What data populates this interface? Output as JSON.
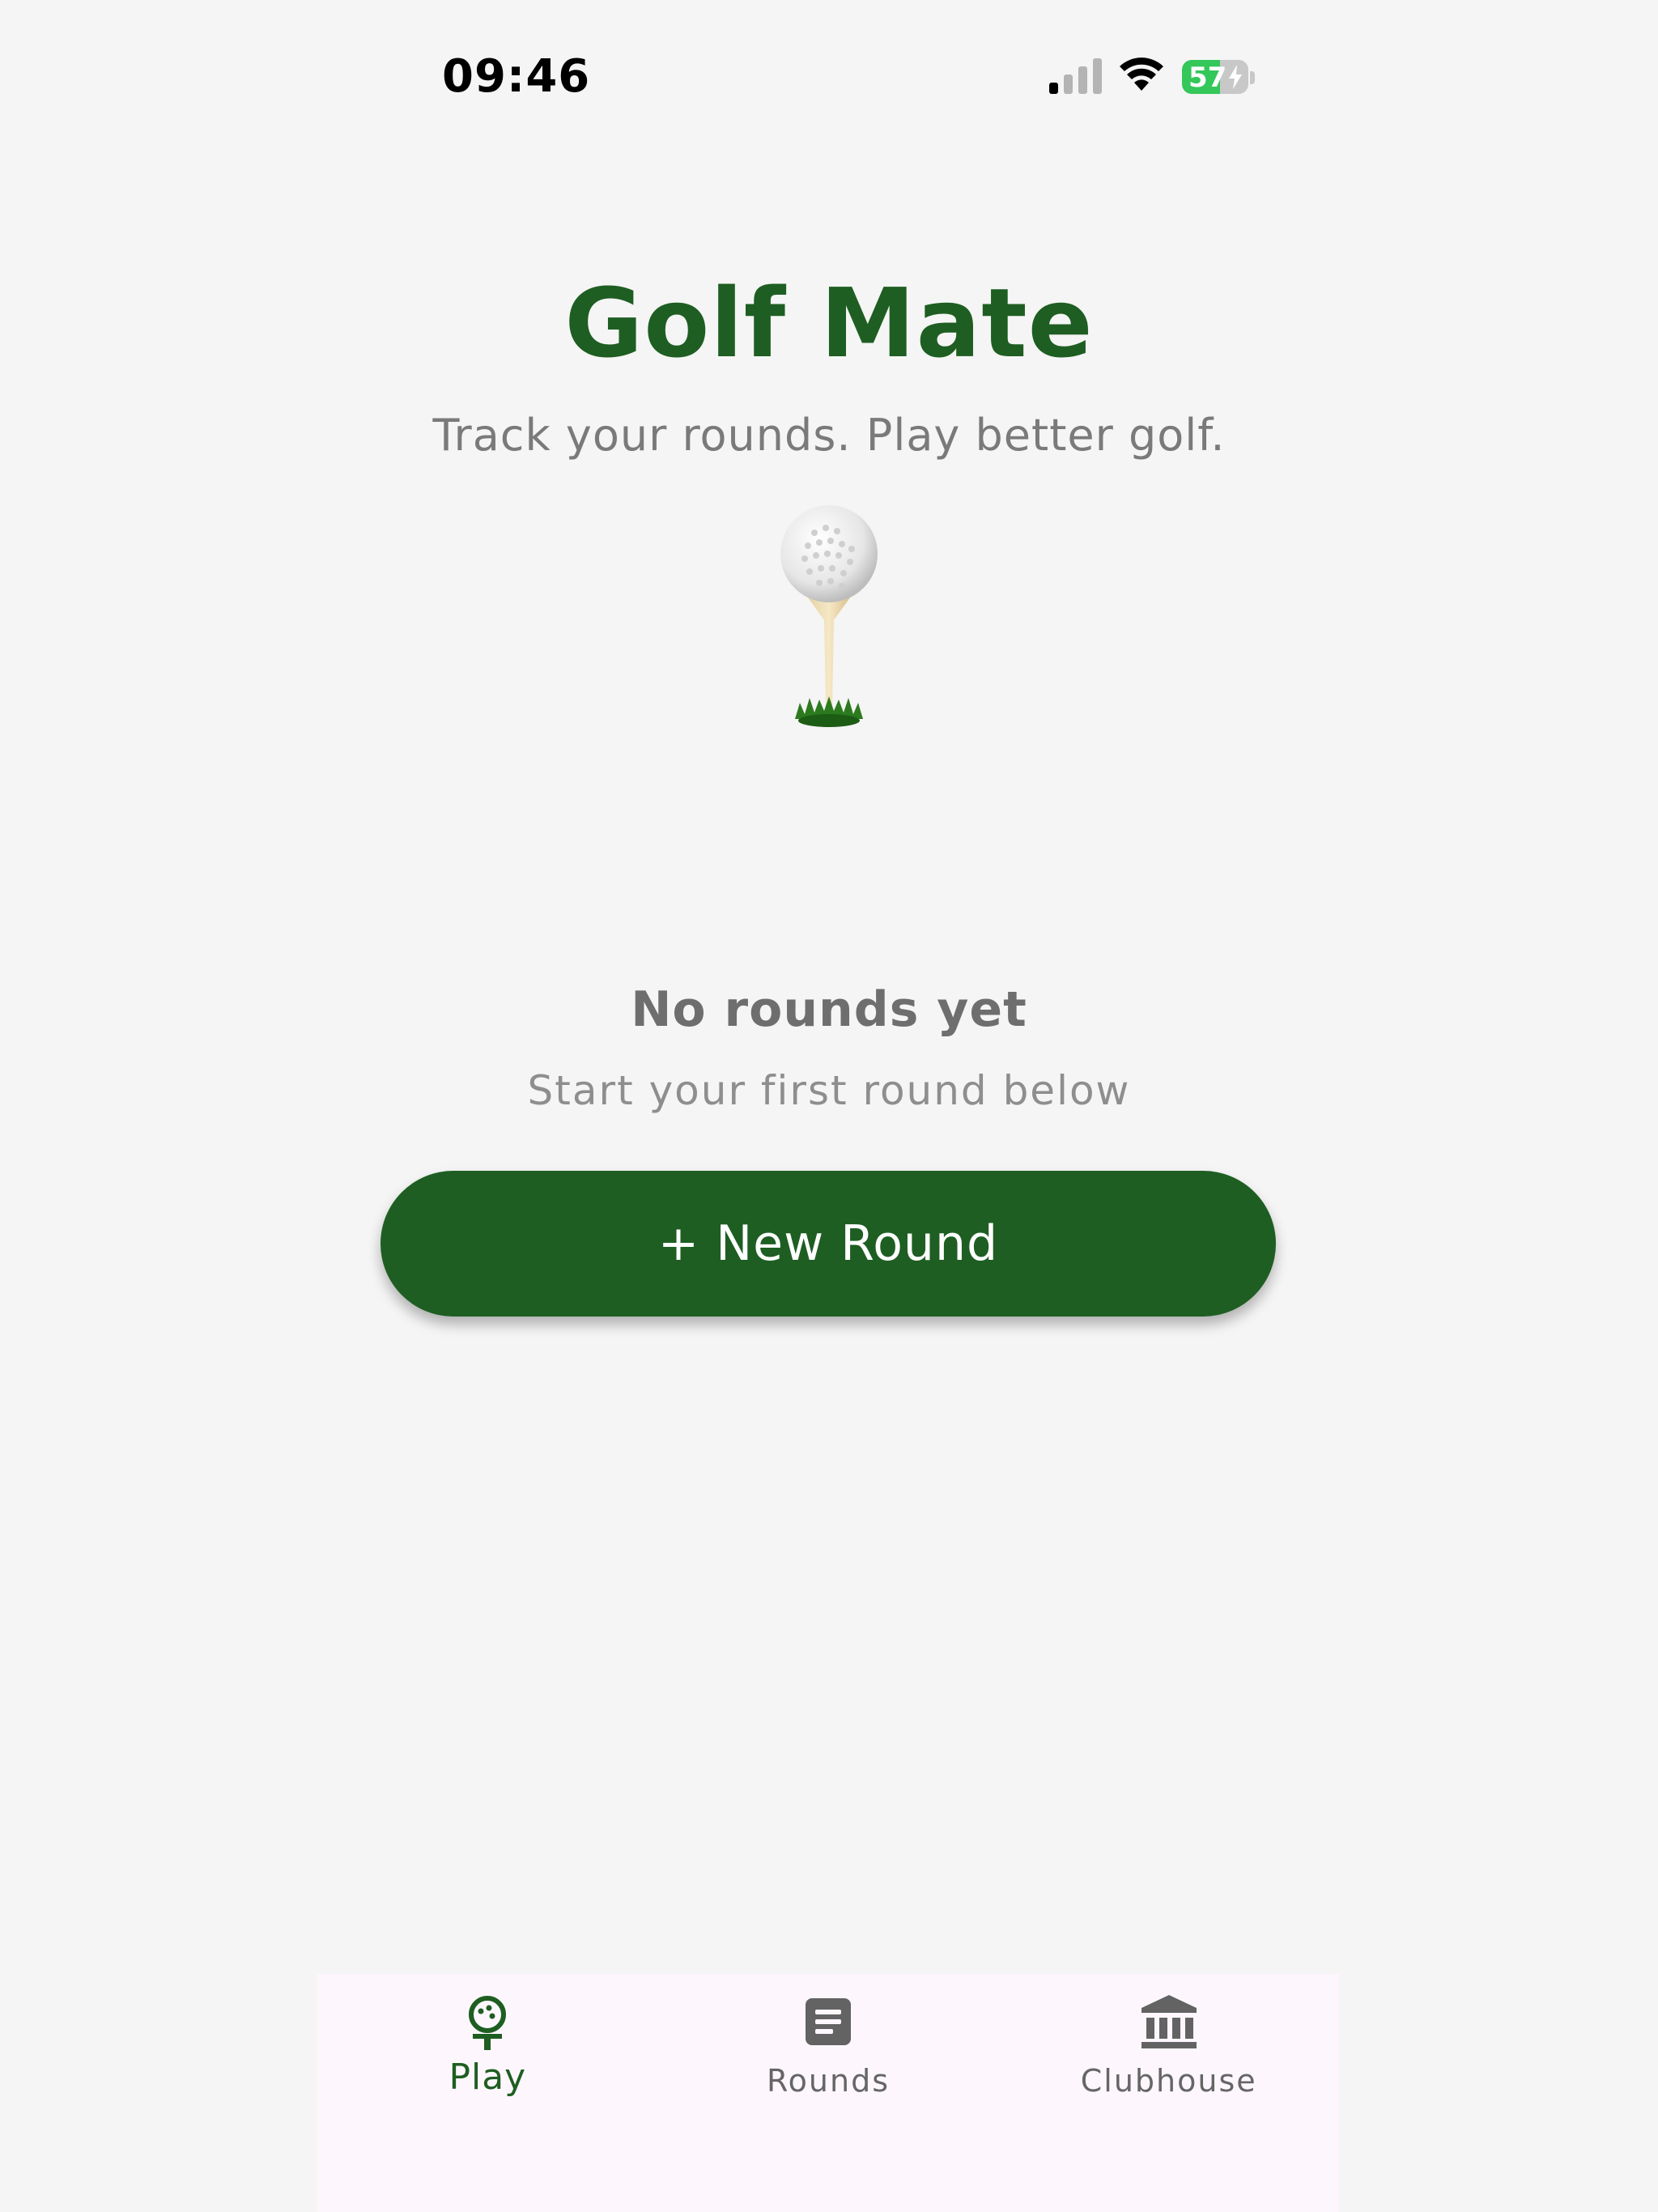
{
  "status_bar": {
    "time": "09:46",
    "battery_level": "57",
    "battery_fraction": 0.57,
    "icons": [
      "signal-icon",
      "wifi-icon",
      "battery-icon"
    ]
  },
  "header": {
    "title": "Golf Mate",
    "tagline": "Track your rounds. Play better golf.",
    "illustration": "golf-ball-on-tee-icon"
  },
  "empty_state": {
    "title": "No rounds yet",
    "subtitle": "Start your first round below"
  },
  "actions": {
    "new_round_label": "+ New Round"
  },
  "bottom_nav": {
    "items": [
      {
        "label": "Play",
        "icon": "golf-tee-icon",
        "active": true
      },
      {
        "label": "Rounds",
        "icon": "document-list-icon",
        "active": false
      },
      {
        "label": "Clubhouse",
        "icon": "clubhouse-building-icon",
        "active": false
      }
    ]
  },
  "colors": {
    "brand_green": "#1e5e22",
    "background": "#f5f5f5",
    "nav_background": "#fdf7fd",
    "battery_green": "#34c759"
  }
}
